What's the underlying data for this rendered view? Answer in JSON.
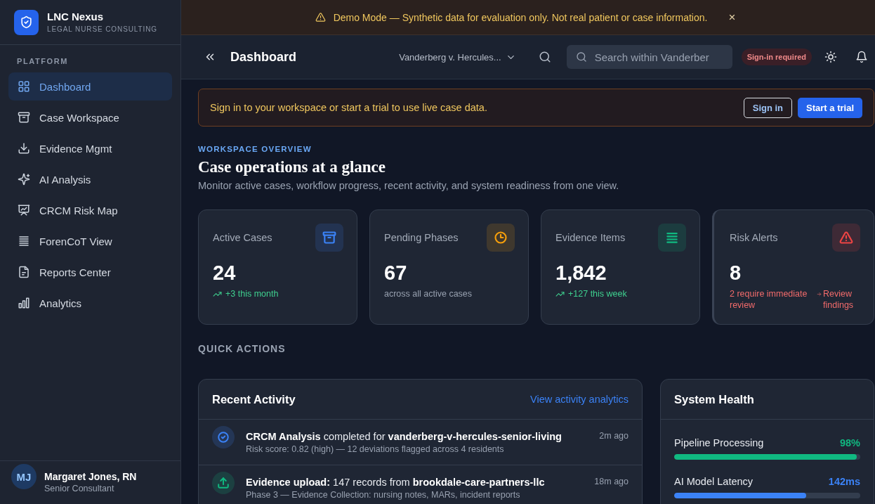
{
  "demo_banner": {
    "text": "Demo Mode — Synthetic data for evaluation only. Not real patient or case information.",
    "close": "×"
  },
  "sidebar": {
    "brand": {
      "name": "LNC Nexus",
      "tagline": "LEGAL NURSE CONSULTING"
    },
    "section": "PLATFORM",
    "items": [
      {
        "label": "Dashboard",
        "selected": true
      },
      {
        "label": "Case Workspace",
        "selected": false
      },
      {
        "label": "Evidence Mgmt",
        "selected": false
      },
      {
        "label": "AI Analysis",
        "selected": false
      },
      {
        "label": "CRCM Risk Map",
        "selected": false
      },
      {
        "label": "ForenCoT View",
        "selected": false
      },
      {
        "label": "Reports Center",
        "selected": false
      },
      {
        "label": "Analytics",
        "selected": false
      }
    ],
    "user": {
      "initials": "MJ",
      "name": "Margaret Jones, RN",
      "role": "Senior Consultant"
    }
  },
  "header": {
    "title": "Dashboard",
    "case_selector": "Vanderberg v. Hercules...",
    "search": {
      "placeholder": "Search within Vanderber"
    },
    "status_badge": "Sign-in required"
  },
  "signin_banner": {
    "text": "Sign in to your workspace or start a trial to use live case data.",
    "buttons": [
      {
        "label": "Sign in",
        "kind": "outline"
      },
      {
        "label": "Start a trial",
        "kind": "primary"
      }
    ]
  },
  "overview": {
    "eyebrow": "WORKSPACE OVERVIEW",
    "title": "Case operations at a glance",
    "description": "Monitor active cases, workflow progress, recent activity, and system readiness from one view."
  },
  "stats": [
    {
      "label": "Active Cases",
      "value": "24",
      "kind": "trend",
      "note": "+3 this month",
      "color": "#3b82f6"
    },
    {
      "label": "Pending Phases",
      "value": "67",
      "kind": "plain",
      "note": "across all active cases",
      "color": "#f59e0b"
    },
    {
      "label": "Evidence Items",
      "value": "1,842",
      "kind": "trend",
      "note": "+127 this week",
      "color": "#10b981"
    },
    {
      "label": "Risk Alerts",
      "value": "8",
      "kind": "alert",
      "note": "2 require immediate review",
      "link": "Review findings",
      "color": "#ef4444"
    }
  ],
  "quick_actions": {
    "title": "QUICK ACTIONS"
  },
  "recent_activity": {
    "title": "Recent Activity",
    "link": "View activity analytics",
    "rows": [
      {
        "text": "**CRCM Analysis** completed for **vanderberg-v-hercules-senior-living**",
        "detail": "Risk score: 0.82 (high) — 12 deviations flagged across 4 residents",
        "time": "2m ago",
        "color": "#3b82f6"
      },
      {
        "text": "**Evidence upload:** 147 records from **brookdale-care-partners-llc**",
        "detail": "Phase 3 — Evidence Collection: nursing notes, MARs, incident reports",
        "time": "18m ago",
        "color": "#10b981"
      }
    ]
  },
  "system_health": {
    "title": "System Health",
    "items": [
      {
        "label": "Pipeline Processing",
        "reading": "98%",
        "level": 0.98,
        "color": "#10b981"
      },
      {
        "label": "AI Model Latency",
        "reading": "142ms",
        "level": 0.71,
        "color": "#3b82f6"
      }
    ]
  }
}
